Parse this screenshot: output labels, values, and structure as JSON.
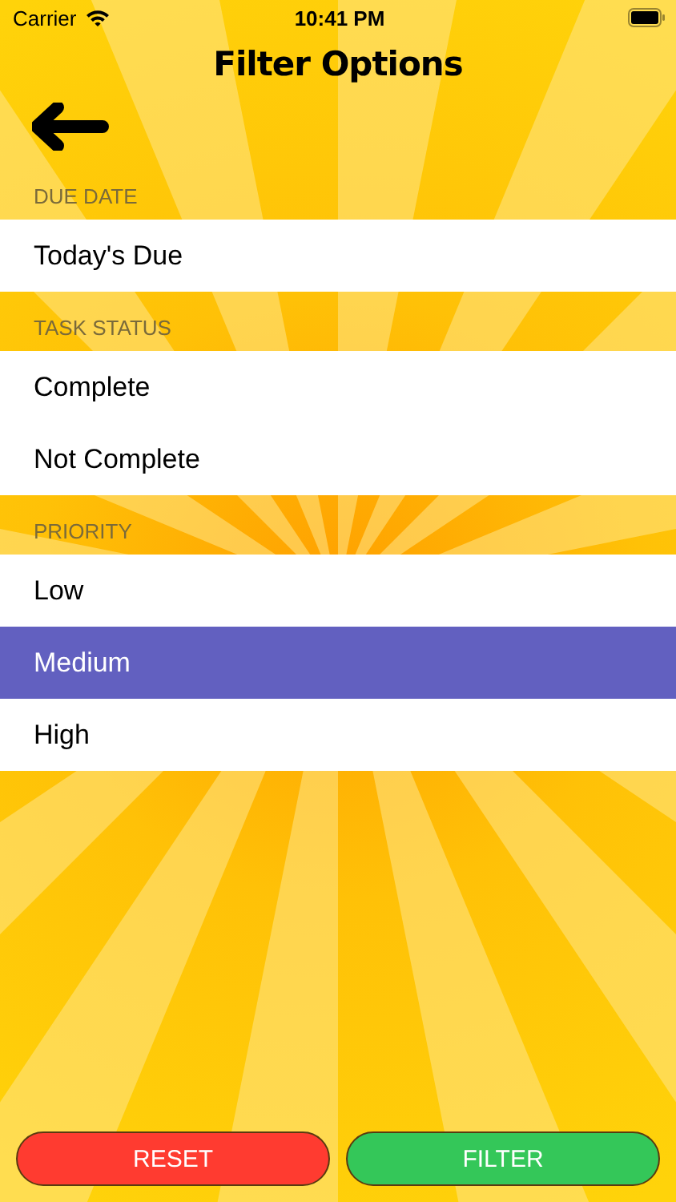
{
  "status_bar": {
    "carrier": "Carrier",
    "time": "10:41 PM"
  },
  "title": "Filter Options",
  "sections": [
    {
      "header": "DUE DATE",
      "options": [
        {
          "label": "Today's Due",
          "selected": false
        }
      ]
    },
    {
      "header": "TASK STATUS",
      "options": [
        {
          "label": "Complete",
          "selected": false
        },
        {
          "label": "Not Complete",
          "selected": false
        }
      ]
    },
    {
      "header": "PRIORITY",
      "options": [
        {
          "label": "Low",
          "selected": false
        },
        {
          "label": "Medium",
          "selected": true
        },
        {
          "label": "High",
          "selected": false
        }
      ]
    }
  ],
  "buttons": [
    {
      "label": "RESET",
      "kind": "reset"
    },
    {
      "label": "FILTER",
      "kind": "filter"
    }
  ]
}
